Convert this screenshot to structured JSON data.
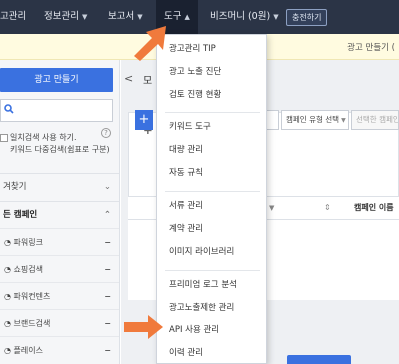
{
  "nav": {
    "items": [
      {
        "label": "고관리",
        "caret": false
      },
      {
        "label": "정보관리",
        "caret": true
      },
      {
        "label": "보고서",
        "caret": true
      },
      {
        "label": "도구",
        "caret": true,
        "active": true
      },
      {
        "label": "비즈머니 (0원)",
        "caret": true
      }
    ],
    "charge_button": "충전하기"
  },
  "notice": {
    "text": "광고 만들기 ("
  },
  "sidebar": {
    "create_button": "광고 만들기",
    "search": {
      "placeholder": ""
    },
    "checkbox_line1": "일치검색 사용 하기.",
    "checkbox_line2": "키워드 다중검색(쉼표로 구분)",
    "help": "?",
    "favorites": "겨찾기",
    "campaign_header": "든 캠페인",
    "campaign_types": [
      "파워링크",
      "쇼핑검색",
      "파워컨텐츠",
      "브랜드검색",
      "플레이스"
    ],
    "minus": "−"
  },
  "main": {
    "back": "<",
    "title_fragment": "모",
    "card_label": "주",
    "add_label": "+",
    "filter_type": "캠페인 유형 선택",
    "filter_disabled": "선택한 캠페인",
    "column_status_frag": "",
    "column_campaign_frag": "캠페인 이름"
  },
  "dropdown": {
    "groups": [
      [
        "광고관리 TIP",
        "광고 노출 진단",
        "검토 진행 현황"
      ],
      [
        "키워드 도구",
        "대량 관리",
        "자동 규칙"
      ],
      [
        "서류 관리",
        "계약 관리",
        "이미지 라이브러리"
      ],
      [
        "프리미엄 로그 분석",
        "광고노출제한 관리",
        "API 사용 관리",
        "이력 관리"
      ]
    ]
  },
  "colors": {
    "nav_bg": "#2b3446",
    "accent_blue": "#3a71e0",
    "arrow_orange": "#f07a3c"
  }
}
